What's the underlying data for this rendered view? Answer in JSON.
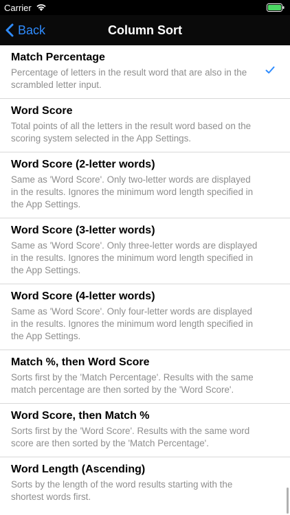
{
  "status": {
    "carrier": "Carrier"
  },
  "nav": {
    "back_label": "Back",
    "title": "Column Sort"
  },
  "items": [
    {
      "title": "Match Percentage",
      "desc": "Percentage of letters in the result word that are also in the scrambled letter input.",
      "selected": true
    },
    {
      "title": "Word Score",
      "desc": "Total points of all the letters in the result word based on the scoring system selected in the App Settings."
    },
    {
      "title": "Word Score (2-letter words)",
      "desc": "Same as 'Word Score'. Only two-letter words are displayed in the results. Ignores the minimum word length specified in the App Settings."
    },
    {
      "title": "Word Score (3-letter words)",
      "desc": "Same as 'Word Score'. Only three-letter words are displayed in the results. Ignores the minimum word length specified in the App Settings."
    },
    {
      "title": "Word Score (4-letter words)",
      "desc": "Same as 'Word Score'. Only four-letter words are displayed in the results. Ignores the minimum word length specified in the App Settings."
    },
    {
      "title": "Match %, then Word Score",
      "desc": "Sorts first by the 'Match Percentage'. Results with the same match percentage are then sorted by the 'Word Score'."
    },
    {
      "title": "Word Score, then Match %",
      "desc": "Sorts first by the 'Word Score'. Results with the same word score are then sorted by the 'Match Percentage'."
    },
    {
      "title": "Word Length (Ascending)",
      "desc": "Sorts by the length of the word results starting with the shortest words first."
    }
  ],
  "colors": {
    "accent": "#2f8cff",
    "battery": "#4cd964"
  },
  "icons": {
    "back": "chevron-left-icon",
    "check": "checkmark-icon",
    "wifi": "wifi-icon",
    "battery": "battery-icon"
  }
}
